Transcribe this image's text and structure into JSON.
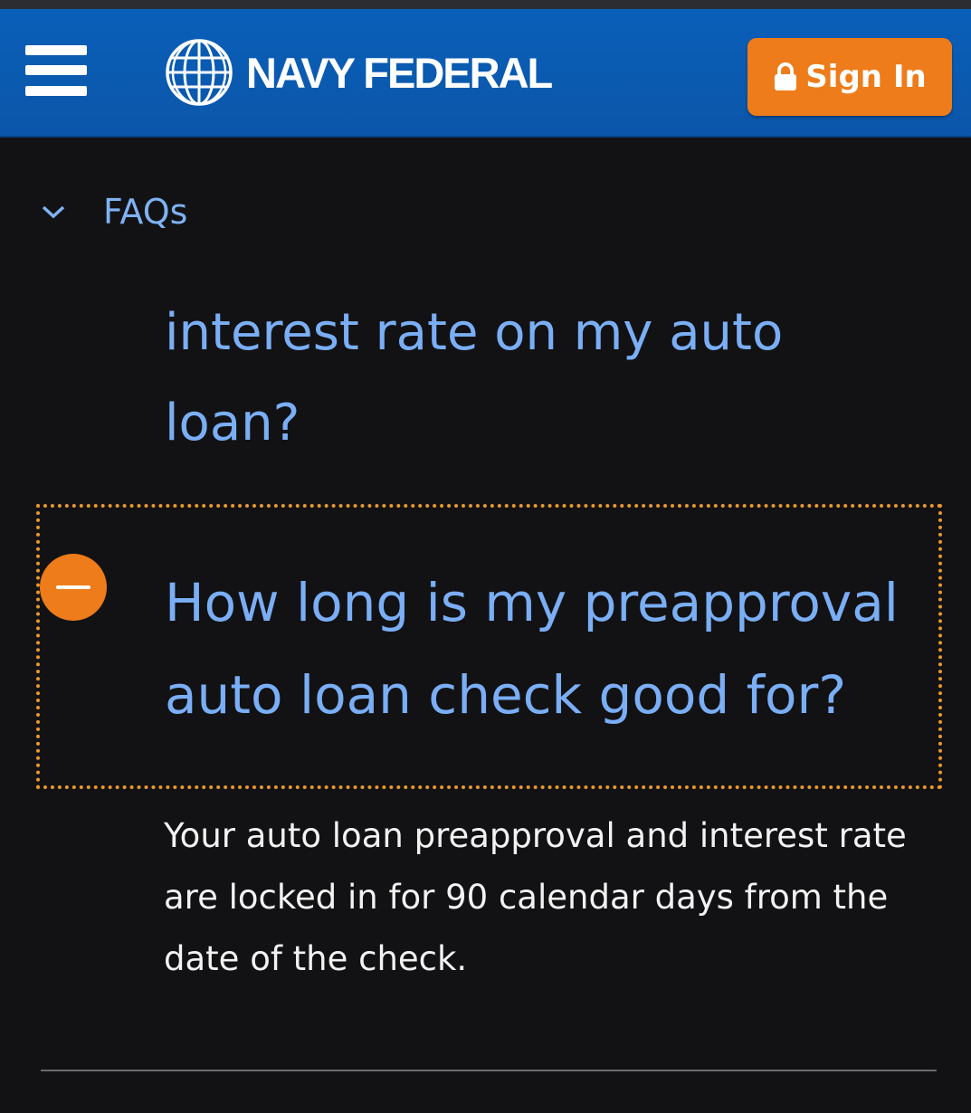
{
  "header": {
    "menu_icon": "hamburger-menu-icon",
    "logo_text": "NAVY FEDERAL",
    "logo_icon": "globe-icon",
    "signin_label": "Sign In",
    "signin_icon": "lock-icon",
    "brand_color": "#0a5fb8",
    "accent_color": "#ee7c1a"
  },
  "breadcrumb": {
    "label": "FAQs",
    "icon": "chevron-down-icon"
  },
  "faq": {
    "previous_question_fragment": "interest rate on my auto loan?",
    "expanded_question": "How long is my preapproval auto loan check good for?",
    "expanded_icon": "minus-circle-icon",
    "answer": "Your auto loan preapproval and interest rate are locked in for 90 calendar days from the date of the check."
  }
}
